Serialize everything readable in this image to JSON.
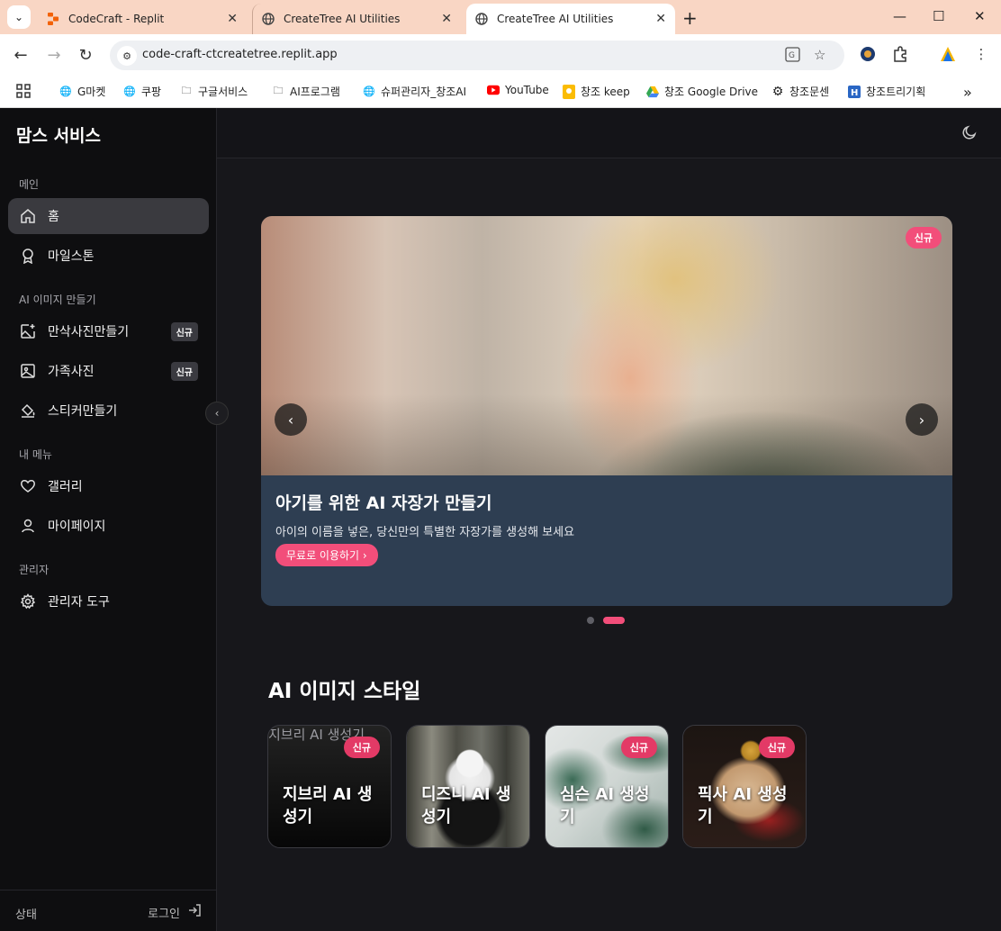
{
  "browser": {
    "tabs": [
      {
        "title": "CodeCraft - Replit"
      },
      {
        "title": "CreateTree AI Utilities"
      },
      {
        "title": "CreateTree AI Utilities"
      }
    ],
    "url": "code-craft-ctcreatetree.replit.app",
    "bookmarks": [
      {
        "label": "G마켓"
      },
      {
        "label": "쿠팡"
      },
      {
        "label": "구글서비스"
      },
      {
        "label": "AI프로그램"
      },
      {
        "label": "슈퍼관리자_창조AI"
      },
      {
        "label": "YouTube"
      },
      {
        "label": "창조 keep"
      },
      {
        "label": "창조 Google Drive"
      },
      {
        "label": "창조문센"
      },
      {
        "label": "창조트리기획"
      }
    ]
  },
  "sidebar": {
    "brand": "맘스 서비스",
    "sections": [
      {
        "title": "메인"
      },
      {
        "title": "AI 이미지 만들기"
      },
      {
        "title": "내 메뉴"
      },
      {
        "title": "관리자"
      }
    ],
    "items": [
      {
        "label": "홈"
      },
      {
        "label": "마일스톤"
      },
      {
        "label": "만삭사진만들기",
        "badge": "신규"
      },
      {
        "label": "가족사진",
        "badge": "신규"
      },
      {
        "label": "스티커만들기"
      },
      {
        "label": "갤러리"
      },
      {
        "label": "마이페이지"
      },
      {
        "label": "관리자 도구"
      }
    ],
    "footer": {
      "status": "상태",
      "login": "로그인"
    }
  },
  "hero": {
    "badge": "신규",
    "title": "아기를 위한 AI 자장가 만들기",
    "subtitle": "아이의 이름을 넣은, 당신만의 특별한 자장가를 생성해 보세요",
    "cta": "무료로 이용하기 ›",
    "slide_count": 2,
    "active_slide": 2
  },
  "styles": {
    "title": "AI 이미지 스타일",
    "cards": [
      {
        "title": "지브리 AI 생성기",
        "badge": "신규",
        "alt_text": "지브리 AI 생성기"
      },
      {
        "title": "디즈니 AI 생성기"
      },
      {
        "title": "심슨 AI 생성기",
        "badge": "신규"
      },
      {
        "title": "픽사 AI 생성기",
        "badge": "신규"
      }
    ]
  },
  "colors": {
    "accent": "#f24e7a",
    "sidebar_bg": "#0e0e10",
    "main_bg": "#17171b",
    "hero_panel": "#2e3e52"
  }
}
